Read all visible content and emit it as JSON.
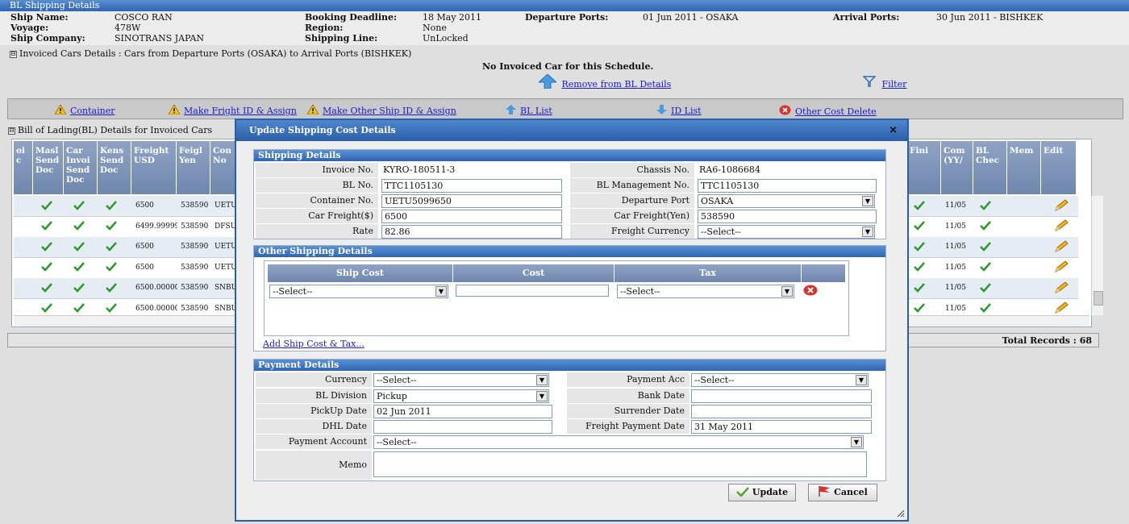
{
  "header": {
    "title": "BL Shipping Details",
    "ship_name_label": "Ship Name:",
    "ship_name": "COSCO RAN",
    "voyage_label": "Voyage:",
    "voyage": "478W",
    "ship_company_label": "Ship Company:",
    "ship_company": "SINOTRANS JAPAN",
    "booking_deadline_label": "Booking Deadline:",
    "booking_deadline": "18 May 2011",
    "region_label": "Region:",
    "region": "None",
    "shipping_line_label": "Shipping Line:",
    "shipping_line": "UnLocked",
    "departure_ports_label": "Departure Ports:",
    "departure_ports": "01 Jun 2011 - OSAKA",
    "arrival_ports_label": "Arrival Ports:",
    "arrival_ports": "30 Jun 2011 - BISHKEK"
  },
  "invoiced_section": {
    "expander": "⊟",
    "title": "Invoiced Cars Details : Cars from Departure Ports (OSAKA) to Arrival Ports (BISHKEK)",
    "empty_message": "No Invoiced Car for this Schedule.",
    "remove_link": "Remove from BL Details",
    "filter_link": "Filter"
  },
  "toolbar": {
    "container": "Container",
    "make_fright": "Make Fright ID & Assign",
    "make_other": "Make Other Ship ID & Assign",
    "bl_list": "BL List",
    "id_list": "ID List",
    "other_cost_delete": "Other Cost Delete"
  },
  "bl_section": {
    "expander": "⊟",
    "title": "Bill of Lading(BL) Details for Invoiced Cars",
    "columns_left": [
      "oi\nc",
      "Masl\nSend\nDoc",
      "Car\nInvoi\nSend\nDoc",
      "Kens\nSend\nDoc",
      "Freight\nUSD",
      "Feigl\nYen",
      "Con\nNo"
    ],
    "columns_right": [
      "Fini",
      "Com\n(YY/",
      "BL\nChec",
      "Mem",
      "Edit"
    ],
    "rows": [
      {
        "freight": "6500",
        "yen": "538590",
        "con": "UETU",
        "date": "11/05"
      },
      {
        "freight": "6499.99999",
        "yen": "538590",
        "con": "DFSU",
        "date": "11/05"
      },
      {
        "freight": "6500",
        "yen": "538590",
        "con": "UETU",
        "date": "11/05"
      },
      {
        "freight": "6500",
        "yen": "538590",
        "con": "UETU",
        "date": "11/05"
      },
      {
        "freight": "6500.00000",
        "yen": "538590",
        "con": "SNBU",
        "date": "11/05"
      },
      {
        "freight": "6500.00000",
        "yen": "538590",
        "con": "SNBU",
        "date": "11/05"
      }
    ],
    "total_records": "Total Records : 68"
  },
  "dialog": {
    "title": "Update Shipping Cost Details",
    "close": "×",
    "shipping": {
      "title": "Shipping Details",
      "invoice_label": "Invoice No.",
      "invoice": "KYRO-180511-3",
      "chassis_label": "Chassis No.",
      "chassis": "RA6-1086684",
      "bl_label": "BL No.",
      "bl": "TTC1105130",
      "bl_mgmt_label": "BL Management No.",
      "bl_mgmt": "TTC1105130",
      "container_label": "Container No.",
      "container": "UETU5099650",
      "dep_port_label": "Departure Port",
      "dep_port": "OSAKA",
      "car_freight_usd_label": "Car Freight($)",
      "car_freight_usd": "6500",
      "car_freight_yen_label": "Car Freight(Yen)",
      "car_freight_yen": "538590",
      "rate_label": "Rate",
      "rate": "82.86",
      "currency_label": "Freight Currency",
      "currency": "--Select--"
    },
    "other": {
      "title": "Other Shipping Details",
      "col_ship_cost": "Ship Cost",
      "col_cost": "Cost",
      "col_tax": "Tax",
      "ship_cost_value": "--Select--",
      "cost_value": "",
      "tax_value": "--Select--",
      "add_link": "Add Ship Cost & Tax..."
    },
    "payment": {
      "title": "Payment Details",
      "currency_label": "Currency",
      "currency": "--Select--",
      "payment_acc_label": "Payment Acc",
      "payment_acc": "--Select--",
      "bl_division_label": "BL Division",
      "bl_division": "Pickup",
      "bank_date_label": "Bank Date",
      "bank_date": "",
      "pickup_date_label": "PickUp Date",
      "pickup_date": "02 Jun 2011",
      "surrender_date_label": "Surrender Date",
      "surrender_date": "",
      "dhl_date_label": "DHL Date",
      "dhl_date": "",
      "freight_payment_date_label": "Freight Payment Date",
      "freight_payment_date": "31 May 2011",
      "payment_account_label": "Payment Account",
      "payment_account": "--Select--",
      "memo_label": "Memo",
      "memo": ""
    },
    "update_button": "Update",
    "cancel_button": "Cancel"
  }
}
